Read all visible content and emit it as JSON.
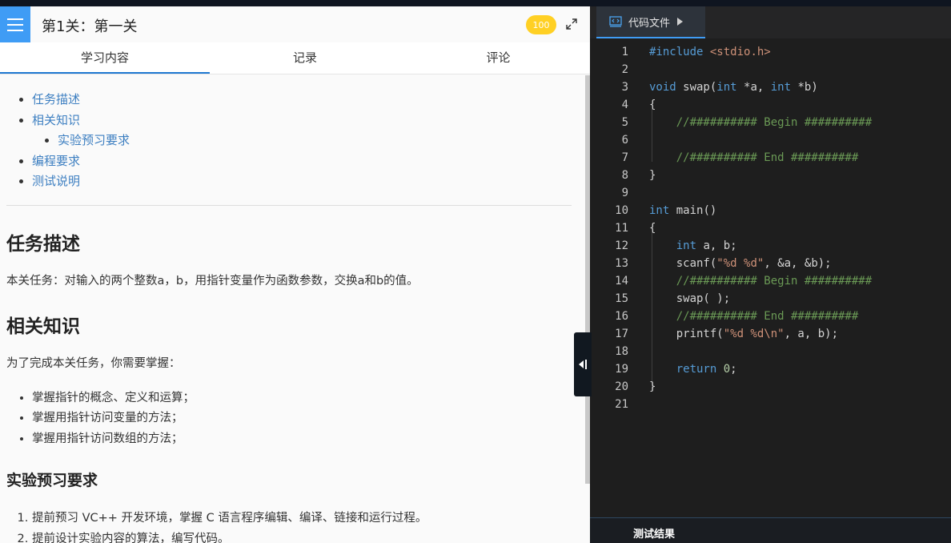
{
  "header": {
    "level_title": "第1关：第一关",
    "score": "100"
  },
  "tabs": [
    {
      "label": "学习内容"
    },
    {
      "label": "记录"
    },
    {
      "label": "评论"
    }
  ],
  "toc": {
    "items": [
      "任务描述",
      "相关知识",
      "实验预习要求",
      "编程要求",
      "测试说明"
    ]
  },
  "content": {
    "sec1_title": "任务描述",
    "sec1_text": "本关任务：对输入的两个整数a，b，用指针变量作为函数参数，交换a和b的值。",
    "sec2_title": "相关知识",
    "sec2_intro": "为了完成本关任务，你需要掌握：",
    "sec2_bullets": [
      "掌握指针的概念、定义和运算；",
      "掌握用指针访问变量的方法；",
      "掌握用指针访问数组的方法；"
    ],
    "sec3_title": "实验预习要求",
    "sec3_items": [
      "提前预习 VC++ 开发环境，掌握 C 语言程序编辑、编译、链接和运行过程。",
      "提前设计实验内容的算法，编写代码。"
    ]
  },
  "editor": {
    "file_tab_label": "代码文件",
    "line_numbers": [
      "1",
      "2",
      "3",
      "4",
      "5",
      "6",
      "7",
      "8",
      "9",
      "10",
      "11",
      "12",
      "13",
      "14",
      "15",
      "16",
      "17",
      "18",
      "19",
      "20",
      "21"
    ],
    "lines": [
      "#include <stdio.h>",
      "",
      "void swap(int *a, int *b)",
      "{",
      "    //########## Begin ##########",
      "",
      "    //########## End ##########",
      "}",
      "",
      "int main()",
      "{",
      "    int a, b;",
      "    scanf(\"%d %d\", &a, &b);",
      "    //########## Begin ##########",
      "    swap( );",
      "    //########## End ##########",
      "    printf(\"%d %d\\n\", a, b);",
      "",
      "    return 0;",
      "}",
      ""
    ]
  },
  "results": {
    "label": "测试结果"
  },
  "colors": {
    "accent": "#3f9cf5",
    "badge": "#ffd024",
    "link": "#3d7fc1",
    "keyword": "#569cd6",
    "string": "#ce9178",
    "comment": "#6a9955"
  },
  "icons": [
    "menu-icon",
    "expand-icon",
    "code-file-icon",
    "play-arrow-icon",
    "collapse-panel-icon"
  ]
}
